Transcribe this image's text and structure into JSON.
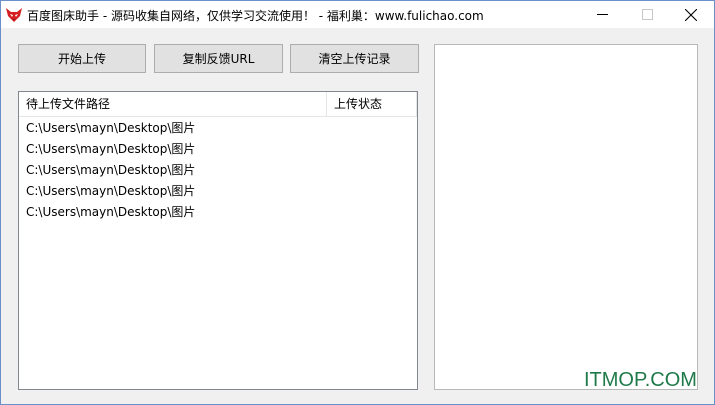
{
  "window": {
    "title": "百度图床助手 - 源码收集自网络，仅供学习交流使用！ - 福利巢：www.fulichao.com",
    "icon": "fox-icon"
  },
  "toolbar": {
    "start_upload": "开始上传",
    "copy_url": "复制反馈URL",
    "clear_records": "清空上传记录"
  },
  "file_list": {
    "columns": [
      "待上传文件路径",
      "上传状态"
    ],
    "rows": [
      {
        "path": "C:\\Users\\mayn\\Desktop\\图片",
        "status": ""
      },
      {
        "path": "C:\\Users\\mayn\\Desktop\\图片",
        "status": ""
      },
      {
        "path": "C:\\Users\\mayn\\Desktop\\图片",
        "status": ""
      },
      {
        "path": "C:\\Users\\mayn\\Desktop\\图片",
        "status": ""
      },
      {
        "path": "C:\\Users\\mayn\\Desktop\\图片",
        "status": ""
      }
    ]
  },
  "watermark": "ITMOP.COM",
  "colors": {
    "window_border": "#6a8fc9",
    "button_bg": "#e1e1e1",
    "watermark": "#1f7a4a"
  }
}
